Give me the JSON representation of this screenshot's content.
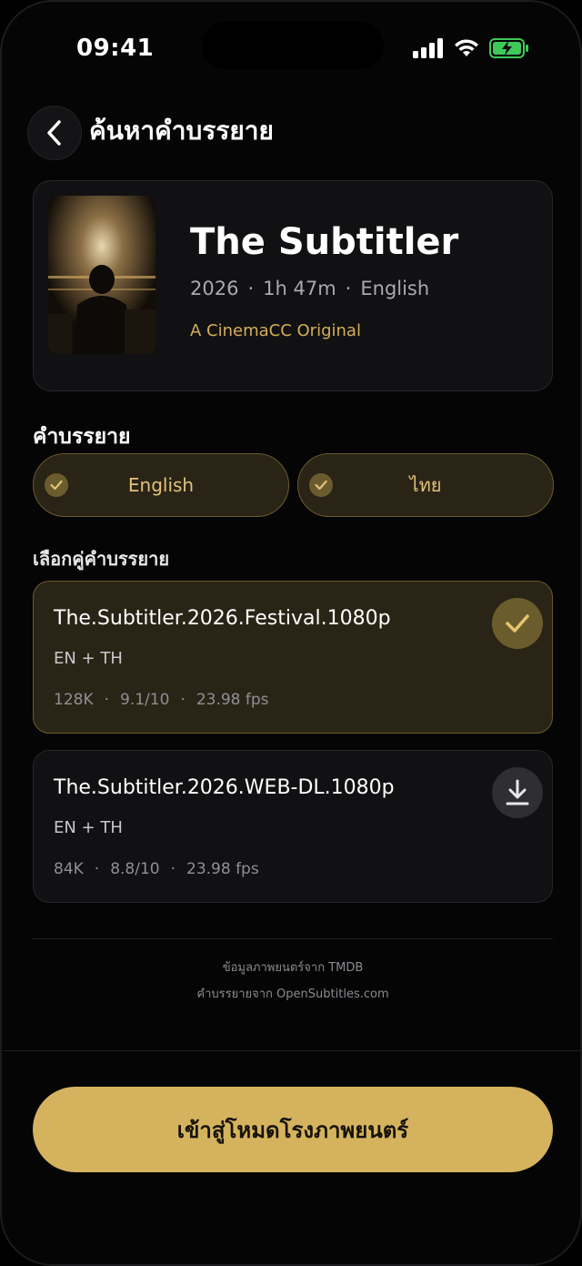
{
  "status": {
    "time": "09:41"
  },
  "header": {
    "title": "ค้นหาคำบรรยาย"
  },
  "movie": {
    "title": "The Subtitler",
    "year": "2026",
    "duration": "1h 47m",
    "language": "English",
    "badge": "A CinemaCC Original"
  },
  "subtitles": {
    "label": "คำบรรยาย",
    "languages": [
      {
        "label": "English",
        "selected": true
      },
      {
        "label": "ไทย",
        "selected": true
      }
    ]
  },
  "pairs": {
    "label": "เลือกคู่คำบรรยาย",
    "items": [
      {
        "name": "The.Subtitler.2026.Festival.1080p",
        "langs": "EN + TH",
        "downloads": "128K",
        "rating": "9.1/10",
        "fps": "23.98 fps",
        "state": "selected",
        "icon": "check-icon"
      },
      {
        "name": "The.Subtitler.2026.WEB-DL.1080p",
        "langs": "EN + TH",
        "downloads": "84K",
        "rating": "8.8/10",
        "fps": "23.98 fps",
        "state": "download",
        "icon": "download-icon"
      }
    ]
  },
  "credits": {
    "line1": "ข้อมูลภาพยนตร์จาก TMDB",
    "line2": "คำบรรยายจาก OpenSubtitles.com"
  },
  "cta": {
    "label": "เข้าสู่โหมดโรงภาพยนตร์"
  },
  "colors": {
    "accent": "#d5b35e",
    "background": "#050506",
    "card": "#111113",
    "selected_card": "#2a2416"
  }
}
